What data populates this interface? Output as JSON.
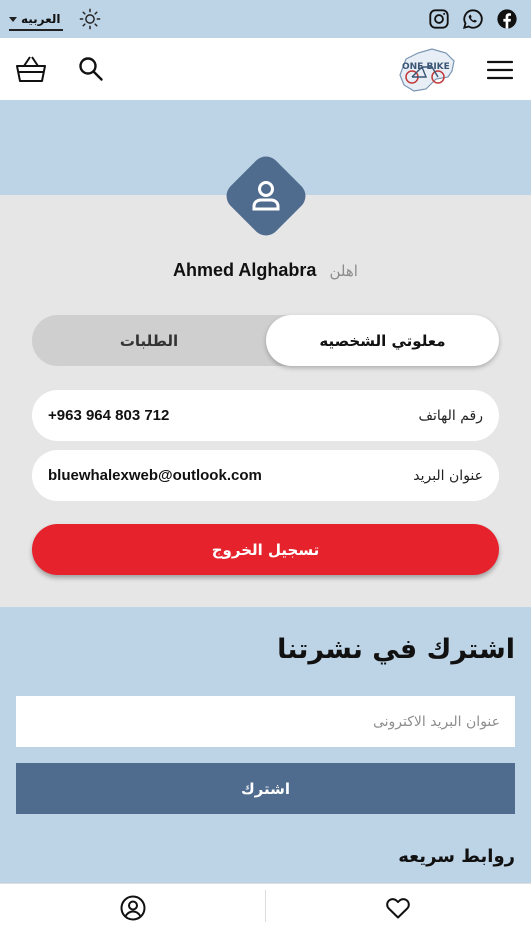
{
  "topbar": {
    "language_label": "العربيه",
    "icons": [
      "facebook-icon",
      "whatsapp-icon",
      "instagram-icon",
      "sun-icon",
      "caret-down-icon"
    ]
  },
  "header": {
    "logo_text": "ONE BIKE",
    "icons": [
      "basket-icon",
      "search-icon",
      "hamburger-menu-icon"
    ]
  },
  "profile": {
    "greeting_prefix": "اهلن",
    "user_name": "Ahmed Alghabra",
    "tabs": {
      "personal_info": "معلوتي الشخصيه",
      "orders": "الطلبات"
    },
    "fields": {
      "phone_label": "رقم الهاتف",
      "phone_value": "+963 964 803 712",
      "email_label": "عنوان البريد",
      "email_value": "bluewhalexweb@outlook.com"
    },
    "logout_label": "تسجيل الخروج"
  },
  "newsletter": {
    "title": "اشترك في نشرتنا",
    "email_placeholder": "عنوان البريد الاكترونى",
    "subscribe_label": "اشترك"
  },
  "footer": {
    "quick_links_title": "روابط سريعه"
  },
  "bottom_nav": {
    "icons": [
      "account-icon",
      "heart-icon"
    ]
  },
  "colors": {
    "page_background": "#bdd3e6",
    "profile_background": "#e6e6e6",
    "accent_blue": "#4f6c8f",
    "logout_red": "#e6232d",
    "tab_track": "#cfcfcf"
  }
}
